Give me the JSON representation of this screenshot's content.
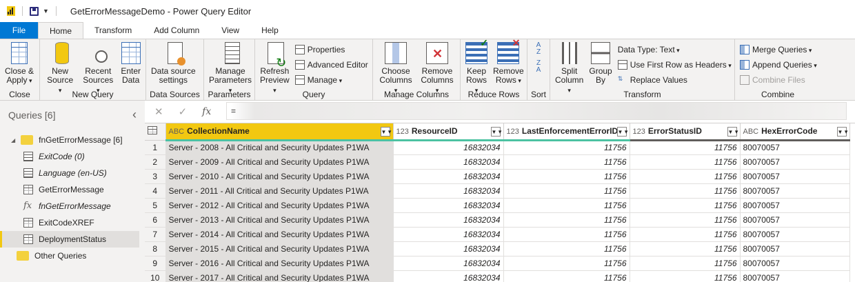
{
  "titlebar": {
    "title": "GetErrorMessageDemo - Power Query Editor"
  },
  "tabs": [
    "File",
    "Home",
    "Transform",
    "Add Column",
    "View",
    "Help"
  ],
  "ribbon": {
    "close": {
      "label1": "Close &",
      "label2": "Apply",
      "group": "Close"
    },
    "new_query": {
      "new_source1": "New",
      "new_source2": "Source",
      "recent1": "Recent",
      "recent2": "Sources",
      "enter1": "Enter",
      "enter2": "Data",
      "group": "New Query"
    },
    "data_sources": {
      "label1": "Data source",
      "label2": "settings",
      "group": "Data Sources"
    },
    "parameters": {
      "label1": "Manage",
      "label2": "Parameters",
      "group": "Parameters"
    },
    "query": {
      "refresh1": "Refresh",
      "refresh2": "Preview",
      "properties": "Properties",
      "advanced": "Advanced Editor",
      "manage": "Manage",
      "group": "Query"
    },
    "manage_columns": {
      "choose1": "Choose",
      "choose2": "Columns",
      "remove1": "Remove",
      "remove2": "Columns",
      "group": "Manage Columns"
    },
    "reduce_rows": {
      "keep1": "Keep",
      "keep2": "Rows",
      "remove1": "Remove",
      "remove2": "Rows",
      "group": "Reduce Rows"
    },
    "sort": {
      "az": "A Z",
      "za": "Z A",
      "group": "Sort"
    },
    "transform": {
      "split1": "Split",
      "split2": "Column",
      "group1": "Group",
      "group2": "By",
      "data_type": "Data Type: Text",
      "first_row": "Use First Row as Headers",
      "replace": "Replace Values",
      "group": "Transform"
    },
    "combine": {
      "merge": "Merge Queries",
      "append": "Append Queries",
      "files": "Combine Files",
      "group": "Combine"
    }
  },
  "formula_bar": {
    "cancel": "✕",
    "confirm": "✓",
    "fx": "fx",
    "formula": "="
  },
  "queries": {
    "title": "Queries [6]",
    "collapse": "‹",
    "folder1": "fnGetErrorMessage [6]",
    "items": [
      {
        "label": "ExitCode (0)",
        "kind": "param"
      },
      {
        "label": "Language (en-US)",
        "kind": "param"
      },
      {
        "label": "GetErrorMessage",
        "kind": "table"
      },
      {
        "label": "fnGetErrorMessage",
        "kind": "function"
      },
      {
        "label": "ExitCodeXREF",
        "kind": "table"
      },
      {
        "label": "DeploymentStatus",
        "kind": "table"
      }
    ],
    "folder2": "Other Queries"
  },
  "table": {
    "columns": [
      {
        "type": "ABC",
        "name": "CollectionName"
      },
      {
        "type": "123",
        "name": "ResourceID"
      },
      {
        "type": "123",
        "name": "LastEnforcementErrorID"
      },
      {
        "type": "123",
        "name": "ErrorStatusID"
      },
      {
        "type": "ABC",
        "name": "HexErrorCode"
      }
    ],
    "rows": [
      [
        "1",
        "Server - 2008 - All Critical and Security Updates P1WA",
        "16832034",
        "11756",
        "11756",
        "80070057"
      ],
      [
        "2",
        "Server - 2009 - All Critical and Security Updates P1WA",
        "16832034",
        "11756",
        "11756",
        "80070057"
      ],
      [
        "3",
        "Server - 2010 - All Critical and Security Updates P1WA",
        "16832034",
        "11756",
        "11756",
        "80070057"
      ],
      [
        "4",
        "Server - 2011 - All Critical and Security Updates P1WA",
        "16832034",
        "11756",
        "11756",
        "80070057"
      ],
      [
        "5",
        "Server - 2012 - All Critical and Security Updates P1WA",
        "16832034",
        "11756",
        "11756",
        "80070057"
      ],
      [
        "6",
        "Server - 2013 - All Critical and Security Updates P1WA",
        "16832034",
        "11756",
        "11756",
        "80070057"
      ],
      [
        "7",
        "Server - 2014 - All Critical and Security Updates P1WA",
        "16832034",
        "11756",
        "11756",
        "80070057"
      ],
      [
        "8",
        "Server - 2015 - All Critical and Security Updates P1WA",
        "16832034",
        "11756",
        "11756",
        "80070057"
      ],
      [
        "9",
        "Server - 2016 - All Critical and Security Updates P1WA",
        "16832034",
        "11756",
        "11756",
        "80070057"
      ],
      [
        "10",
        "Server - 2017 - All Critical and Security Updates P1WA",
        "16832034",
        "11756",
        "11756",
        "80070057"
      ]
    ]
  },
  "colors": {
    "accent": "#0078d4",
    "brand": "#f2c811",
    "quality": "#4cc2a2"
  }
}
